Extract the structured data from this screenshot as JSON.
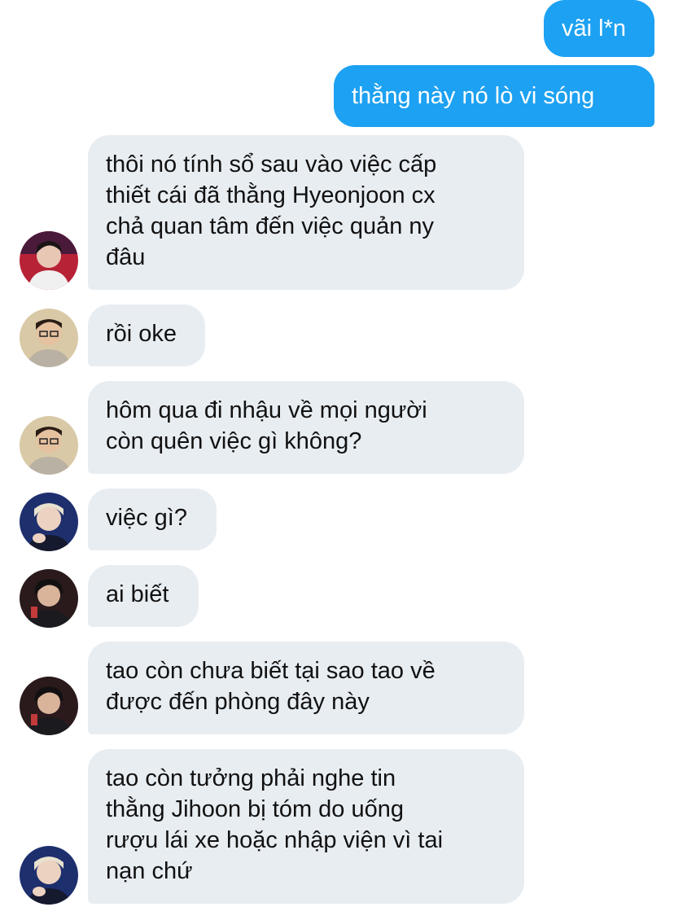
{
  "messages": [
    {
      "direction": "sent",
      "text": "vãi l*n"
    },
    {
      "direction": "sent",
      "text": "thằng này nó lò vi sóng"
    },
    {
      "direction": "received",
      "avatar": "avatar-red-jersey",
      "text": "thôi nó tính sổ sau vào việc cấp\nthiết cái đã thằng Hyeonjoon cx\nchả quan tâm đến việc quản ny\nđâu"
    },
    {
      "direction": "received",
      "avatar": "avatar-glasses",
      "text": "rồi oke"
    },
    {
      "direction": "received",
      "avatar": "avatar-glasses",
      "text": "hôm qua đi nhậu về mọi người\ncòn quên việc gì không?"
    },
    {
      "direction": "received",
      "avatar": "avatar-blond-blue",
      "text": "việc gì?"
    },
    {
      "direction": "received",
      "avatar": "avatar-headset-dark",
      "text": "ai biết"
    },
    {
      "direction": "received",
      "avatar": "avatar-headset-dark",
      "text": "tao còn chưa biết tại sao tao về\nđược đến phòng đây này"
    },
    {
      "direction": "received",
      "avatar": "avatar-blond-blue",
      "text": "tao còn tưởng phải nghe tin\nthằng Jihoon bị tóm do uống\nrượu lái xe hoặc nhập viện vì tai\nnạn chứ"
    }
  ],
  "colors": {
    "sent_bubble": "#1da1f2",
    "received_bubble": "#e8edf2",
    "sent_text": "#ffffff",
    "received_text": "#111111"
  }
}
